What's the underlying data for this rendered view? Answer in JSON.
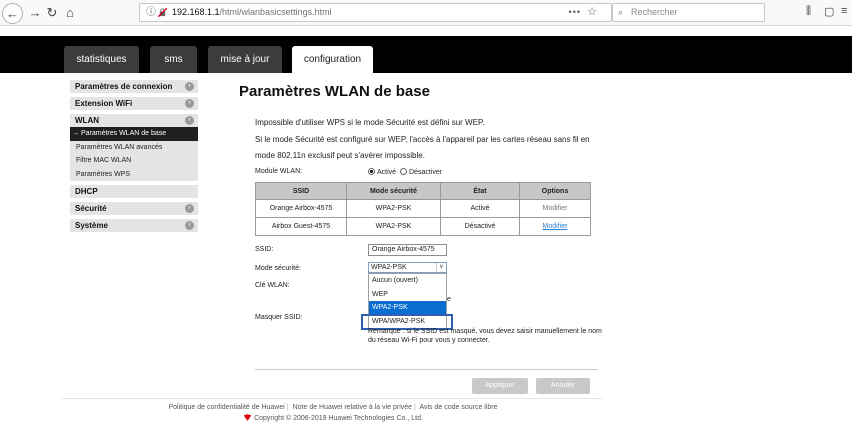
{
  "browser": {
    "url_host": "192.168.1.1",
    "url_path": "/html/wlanbasicsettings.html",
    "more": "•••",
    "search_placeholder": "Rechercher"
  },
  "tabs": [
    {
      "label": "statistiques"
    },
    {
      "label": "sms"
    },
    {
      "label": "mise à jour"
    },
    {
      "label": "configuration"
    }
  ],
  "menu": {
    "items": [
      {
        "label": "Paramètres de connexion"
      },
      {
        "label": "Extension WiFi"
      },
      {
        "label": "WLAN"
      },
      {
        "label": "DHCP"
      },
      {
        "label": "Sécurité"
      },
      {
        "label": "Système"
      }
    ],
    "wlan_sub": [
      {
        "label": "Paramètres WLAN de base"
      },
      {
        "label": "Paramètres WLAN avancés"
      },
      {
        "label": "Filtre MAC WLAN"
      },
      {
        "label": "Paramètres WPS"
      }
    ]
  },
  "content": {
    "title": "Paramètres WLAN de base",
    "intro_line1": "Impossible d'utiliser WPS si le mode Sécurité est défini sur WEP.",
    "intro_line2": "Si le mode Sécurité est configuré sur WEP, l'accès à l'appareil par les cartes réseau sans fil en mode 802.11n exclusif peut s'avérer impossible.",
    "module_label": "Module WLAN:",
    "module_on": "Activé",
    "module_off": "Désactiver",
    "table": {
      "headers": [
        "SSID",
        "Mode sécurité",
        "État",
        "Options"
      ],
      "rows": [
        {
          "ssid": "Orange Airbox-4575",
          "mode": "WPA2-PSK",
          "state": "Activé",
          "option": "Modifier"
        },
        {
          "ssid": "Airbox Guest-4575",
          "mode": "WPA2-PSK",
          "state": "Désactivé",
          "option": "Modifier"
        }
      ]
    },
    "ssid_label": "SSID:",
    "ssid_value": "Orange Airbox-4575",
    "mode_label": "Mode sécurité:",
    "mode_value": "WPA2-PSK",
    "key_label": "Clé WLAN:",
    "hide_label": "Masquer SSID:",
    "dropdown_options": [
      "Aucun (ouvert)",
      "WEP",
      "WPA2-PSK",
      "WPA/WPA2-PSK"
    ],
    "under_fragment": "e",
    "note": "Remarque : si le SSID est masqué, vous devez saisir manuellement le nom du réseau Wi-Fi pour vous y connecter.",
    "apply": "Appliquer",
    "cancel": "Annuler"
  },
  "footer": {
    "links": [
      "Politique de confidentialité de Huawei",
      "Note de Huawei relative à la vie privée",
      "Avis de code source libre"
    ],
    "copyright": "Copyright © 2006-2019 Huawei Technologies Co., Ltd."
  },
  "colors": {
    "header_bg": "#000000",
    "selected_option": "#0a6ed1",
    "highlight_border": "#2f5fae",
    "link": "#2a7fd4"
  }
}
